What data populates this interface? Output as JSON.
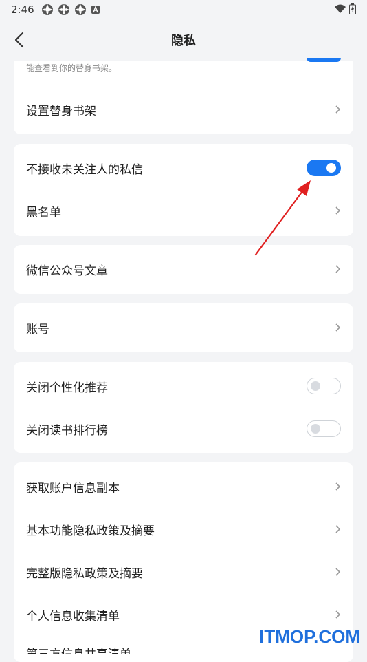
{
  "status": {
    "time": "2:46"
  },
  "header": {
    "title": "隐私"
  },
  "card0": {
    "partial_text": "能查看到你的替身书架。",
    "item": "设置替身书架"
  },
  "card1": {
    "dm_label": "不接收未关注人的私信",
    "dm_toggle": true,
    "blacklist": "黑名单"
  },
  "card2": {
    "item": "微信公众号文章"
  },
  "card3": {
    "item": "账号"
  },
  "card4": {
    "personalized_label": "关闭个性化推荐",
    "personalized_toggle": false,
    "ranking_label": "关闭读书排行榜",
    "ranking_toggle": false
  },
  "card5": {
    "items": [
      "获取账户信息副本",
      "基本功能隐私政策及摘要",
      "完整版隐私政策及摘要",
      "个人信息收集清单"
    ],
    "partial_item": "第三方信息共享清单"
  },
  "watermark": "ITMOP.COM",
  "colors": {
    "accent": "#1a78f2",
    "arrow": "#e02020",
    "background": "#f3f4f6"
  }
}
